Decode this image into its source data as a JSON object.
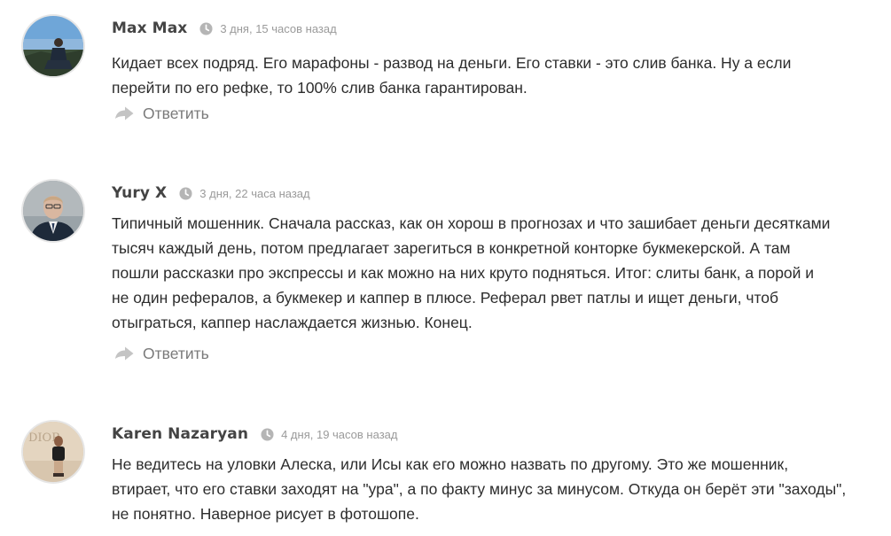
{
  "comments": [
    {
      "author": "Max Max",
      "time": "3 дня, 15 часов назад",
      "lines": [
        "Кидает всех подряд. Его марафоны - развод на деньги. Его ставки - это слив банка. Ну а если",
        "перейти по его рефке, то 100% слив банка гарантирован."
      ],
      "reply_label": "Ответить"
    },
    {
      "author": "Yury X",
      "time": "3 дня, 22 часа назад",
      "lines": [
        "Типичный мошенник. Сначала рассказ, как он хорош в прогнозах и что зашибает деньги десятками",
        "тысяч каждый день, потом предлагает зарегиться в конкретной конторке букмекерской. А там",
        "пошли рассказки про экспрессы и как можно на них круто подняться. Итог: слиты банк, а порой и",
        "не один рефералов, а букмекер и каппер в плюсе. Реферал рвет патлы и ищет деньги, чтоб",
        "отыграться, каппер наслаждается жизнью. Конец."
      ],
      "reply_label": "Ответить"
    },
    {
      "author": "Karen Nazaryan",
      "time": "4 дня, 19 часов назад",
      "lines": [
        "Не ведитесь на уловки Алеска, или Исы как его можно назвать по другому. Это же мошенник,",
        "втирает, что его ставки заходят на \"ура\", а по факту минус за минусом. Откуда он берёт эти \"заходы\",",
        "не понятно. Наверное рисует в фотошопе."
      ],
      "avatar_text": "DIOR"
    }
  ],
  "colors": {
    "author": "#444444",
    "time": "#9a9a9a",
    "text": "#2d2d2d",
    "reply": "#7a7a7a",
    "icon": "#b5b5b5"
  },
  "icons": {
    "time": "clock-icon",
    "reply": "reply-arrow-icon"
  }
}
